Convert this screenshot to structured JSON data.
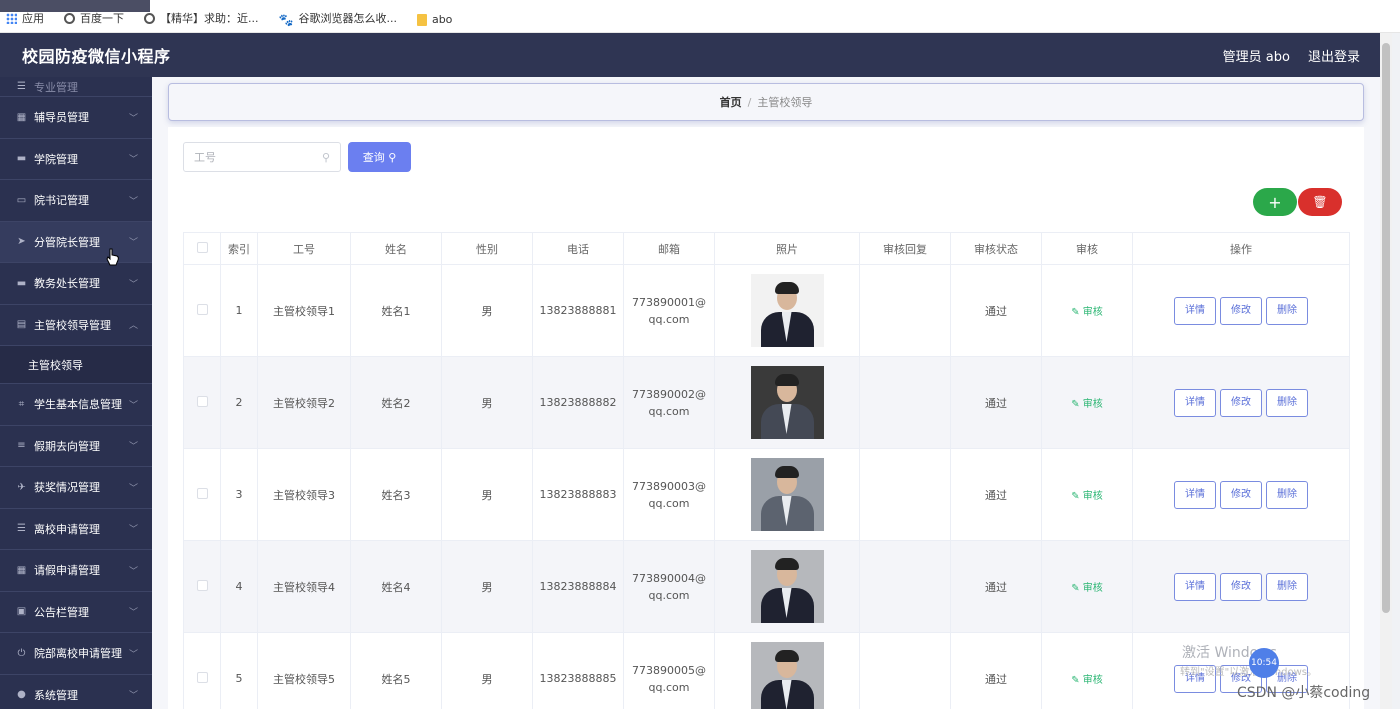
{
  "bookmarks": [
    {
      "icon": "apps-icon",
      "label": "应用"
    },
    {
      "icon": "globe-icon",
      "label": "百度一下"
    },
    {
      "icon": "globe-icon",
      "label": "【精华】求助：近..."
    },
    {
      "icon": "paw-icon",
      "label": "谷歌浏览器怎么收..."
    },
    {
      "icon": "folder-icon",
      "label": "abo"
    }
  ],
  "header": {
    "title": "校园防疫微信小程序",
    "admin": "管理员 abo",
    "logout": "退出登录"
  },
  "sidebar": {
    "partial": "专业管理",
    "items": [
      {
        "label": "辅导员管理",
        "icon": "building-icon"
      },
      {
        "label": "学院管理",
        "icon": "monitor-icon"
      },
      {
        "label": "院书记管理",
        "icon": "card-icon"
      },
      {
        "label": "分管院长管理",
        "icon": "send-icon"
      },
      {
        "label": "教务处长管理",
        "icon": "chat-icon"
      },
      {
        "label": "主管校领导管理",
        "icon": "document-icon"
      },
      {
        "label": "学生基本信息管理",
        "icon": "crop-icon"
      },
      {
        "label": "假期去向管理",
        "icon": "sliders-icon"
      },
      {
        "label": "获奖情况管理",
        "icon": "plane-icon"
      },
      {
        "label": "离校申请管理",
        "icon": "list-icon"
      },
      {
        "label": "请假申请管理",
        "icon": "grid-icon"
      },
      {
        "label": "公告栏管理",
        "icon": "trash-icon"
      },
      {
        "label": "院部离校申请管理",
        "icon": "power-icon"
      },
      {
        "label": "系统管理",
        "icon": "location-icon"
      }
    ],
    "submenu": "主管校领导"
  },
  "breadcrumb": {
    "home": "首页",
    "separator": "/",
    "current": "主管校领导"
  },
  "search": {
    "placeholder": "工号",
    "button": "查询"
  },
  "actions": {
    "add": "+",
    "delete": "🗑"
  },
  "table": {
    "headers": [
      "",
      "索引",
      "工号",
      "姓名",
      "性别",
      "电话",
      "邮箱",
      "照片",
      "审核回复",
      "审核状态",
      "审核",
      "操作"
    ],
    "rows": [
      {
        "index": "1",
        "id": "主管校领导1",
        "name": "姓名1",
        "gender": "男",
        "phone": "13823888881",
        "email": "773890001@qq.com",
        "reply": "",
        "status": "通过",
        "audit": "审核"
      },
      {
        "index": "2",
        "id": "主管校领导2",
        "name": "姓名2",
        "gender": "男",
        "phone": "13823888882",
        "email": "773890002@qq.com",
        "reply": "",
        "status": "通过",
        "audit": "审核"
      },
      {
        "index": "3",
        "id": "主管校领导3",
        "name": "姓名3",
        "gender": "男",
        "phone": "13823888883",
        "email": "773890003@qq.com",
        "reply": "",
        "status": "通过",
        "audit": "审核"
      },
      {
        "index": "4",
        "id": "主管校领导4",
        "name": "姓名4",
        "gender": "男",
        "phone": "13823888884",
        "email": "773890004@qq.com",
        "reply": "",
        "status": "通过",
        "audit": "审核"
      },
      {
        "index": "5",
        "id": "主管校领导5",
        "name": "姓名5",
        "gender": "男",
        "phone": "13823888885",
        "email": "773890005@qq.com",
        "reply": "",
        "status": "通过",
        "audit": "审核"
      }
    ],
    "op_buttons": {
      "detail": "详情",
      "edit": "修改",
      "delete": "删除"
    }
  },
  "overlay": {
    "activate": "激活 Windows",
    "activate_sub": "转到\"设置\"以激活 Windows。",
    "csdn": "CSDN @小蔡coding",
    "clock": "10:54"
  },
  "colors": {
    "header": "#2f3553",
    "sidebar": "#2b3150",
    "primary": "#6b7ff0",
    "add": "#2ba84a",
    "delete": "#d9302c",
    "audit": "#2bb673"
  }
}
